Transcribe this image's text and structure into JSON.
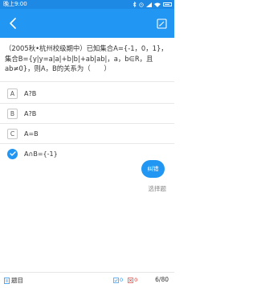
{
  "status_bar": {
    "time": "晚上9:00"
  },
  "question": {
    "text": "（2005秋•杭州校级期中）已知集合A={-1，0，1}，集合B={y|y=a|a|+b|b|+ab|ab|，a，b∈R，且ab≠0}，则A，B的关系为（　　）"
  },
  "options": [
    {
      "letter": "A",
      "text": "A?B",
      "selected": false
    },
    {
      "letter": "B",
      "text": "A?B",
      "selected": false
    },
    {
      "letter": "C",
      "text": "A=B",
      "selected": false
    },
    {
      "letter": "D",
      "text": "A∩B={-1}",
      "selected": true
    }
  ],
  "actions": {
    "error_label": "纠错"
  },
  "meta": {
    "type_label": "选择题"
  },
  "bottom_bar": {
    "topic_label": "题目",
    "correct_count": "0",
    "wrong_count": "0",
    "page": "6/80"
  },
  "colors": {
    "primary": "#2196f3",
    "status_bar": "#1e88e5",
    "wrong": "#e53935"
  },
  "icons": [
    "back-arrow-icon",
    "edit-icon",
    "check-icon",
    "list-icon",
    "correct-icon",
    "wrong-icon"
  ]
}
